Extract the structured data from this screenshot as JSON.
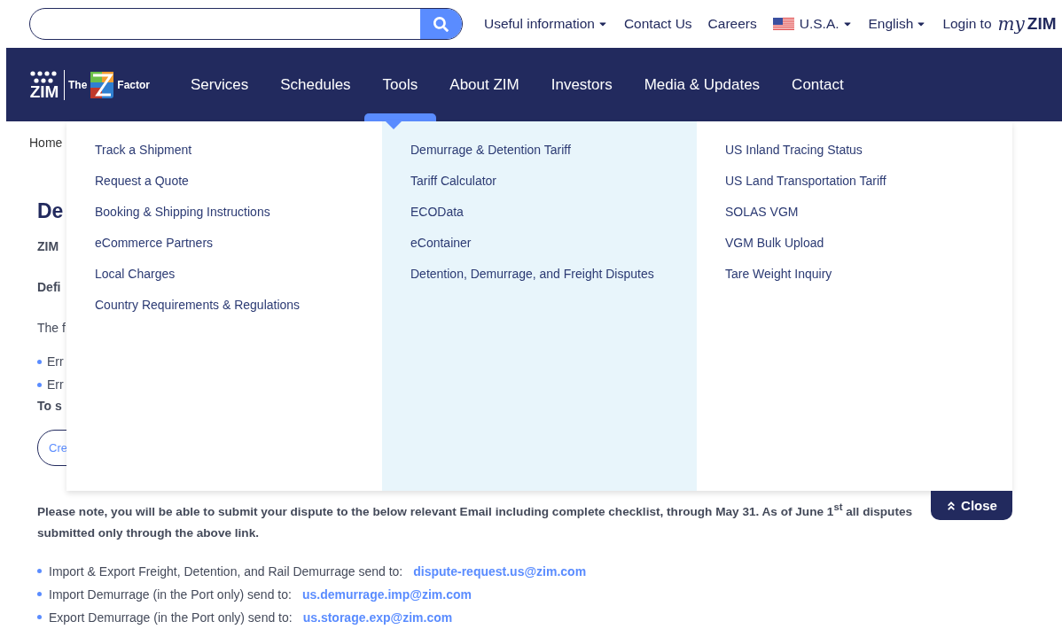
{
  "top_bar": {
    "links": [
      {
        "label": "Useful information",
        "kind": "menu"
      },
      {
        "label": "Contact Us",
        "kind": "link"
      },
      {
        "label": "Careers",
        "kind": "link"
      },
      {
        "label": "U.S.A.",
        "kind": "country"
      },
      {
        "label": "English",
        "kind": "menu"
      }
    ],
    "login": {
      "label": "Login to",
      "logo_script": "my",
      "logo_word": "ZIM"
    }
  },
  "logo": {
    "brand": "ZIM",
    "tagline_start": "The",
    "tagline_end": "Factor"
  },
  "nav": [
    {
      "label": "Services",
      "selected": false
    },
    {
      "label": "Schedules",
      "selected": false
    },
    {
      "label": "Tools",
      "selected": true
    },
    {
      "label": "About ZIM",
      "selected": false
    },
    {
      "label": "Investors",
      "selected": false
    },
    {
      "label": "Media & Updates",
      "selected": false
    },
    {
      "label": "Contact",
      "selected": false
    }
  ],
  "dropdown": {
    "columns": [
      [
        "Track a Shipment",
        "Request a Quote",
        "Booking & Shipping Instructions",
        "eCommerce Partners",
        "Local Charges",
        "Country Requirements & Regulations"
      ],
      [
        "Demurrage & Detention Tariff",
        "Tariff Calculator",
        "ECOData",
        "eContainer",
        "Detention, Demurrage, and Freight Disputes"
      ],
      [
        "US Inland Tracing Status",
        "US Land Transportation Tariff",
        "SOLAS VGM",
        "VGM Bulk Upload",
        "Tare Weight Inquiry"
      ]
    ],
    "close": "Close"
  },
  "page": {
    "breadcrumb": "Home",
    "heading": "De",
    "intro": "ZIM",
    "definition": "Defi",
    "text": "The f",
    "bullets": [
      "Err",
      "Err"
    ],
    "submit_text": "To s",
    "button": "Cre"
  },
  "note_lines": [
    "Please note, you will be able to submit your dispute to the below relevant Email including complete checklist, through May 31. As of June 1$^{st}$ all disputes",
    "submitted only through the above link."
  ],
  "contacts": [
    {
      "text": "Import & Export Freight, Detention, and Rail Demurrage send to:",
      "email": "dispute-request.us@zim.com"
    },
    {
      "text": "Import Demurrage (in the Port only) send to:",
      "email": "us.demurrage.imp@zim.com"
    },
    {
      "text": "Export Demurrage (in the Port only) send to:",
      "email": "us.storage.exp@zim.com"
    }
  ]
}
